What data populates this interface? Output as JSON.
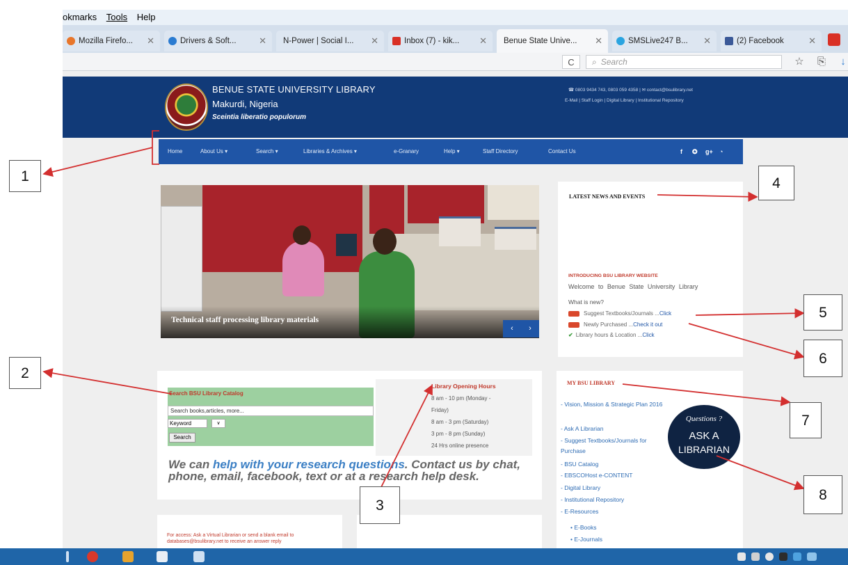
{
  "browser": {
    "menu": [
      "okmarks",
      "Tools",
      "Help"
    ],
    "tabs": [
      {
        "label": "Mozilla Firefo...",
        "color": "#e8762b"
      },
      {
        "label": "Drivers & Soft...",
        "color": "#2a7bd1"
      },
      {
        "label": "N-Power | Social I...",
        "color": "#999999"
      },
      {
        "label": "Inbox (7) - kik...",
        "color": "#d93025"
      },
      {
        "label": "Benue State Unive...",
        "color": "#1a3f7a"
      },
      {
        "label": "SMSLive247 B...",
        "color": "#2aa4e0"
      },
      {
        "label": "(2) Facebook",
        "color": "#3b5998"
      }
    ],
    "reload_icon": "C",
    "search_placeholder": "Search"
  },
  "site": {
    "title": "BENUE STATE UNIVERSITY LIBRARY",
    "location": "Makurdi, Nigeria",
    "motto": "Sceintia liberatio populorum",
    "contact_line": "☎ 0803 9434 743, 0803 059 4358 | ✉ contact@bsulibrary.net",
    "header_links": "E-Mail | Staff Login | Digital Library | Institutional Repository",
    "nav": [
      "Home",
      "About Us ▾",
      "Search ▾",
      "Libraries & Archives ▾",
      "e-Granary",
      "Help ▾",
      "Staff Directory",
      "Contact Us"
    ],
    "social": [
      "f",
      "✪",
      "g+",
      "◔"
    ],
    "slider_caption": "Technical staff processing library materials",
    "slider_prev": "‹",
    "slider_next": "›"
  },
  "news": {
    "title": "LATEST NEWS AND EVENTS",
    "intro": "INTRODUCING BSU LIBRARY WEBSITE",
    "welcome": "Welcome to Benue State University Library",
    "whats_new": "What is new?",
    "items": [
      {
        "text": "Suggest Textbooks/Journals ...",
        "link": "Click"
      },
      {
        "text": "Newly Purchased ...",
        "link": "Check it out"
      },
      {
        "text": "Library hours & Location ...",
        "link": "Click"
      }
    ]
  },
  "catalog": {
    "title": "Search BSU Library Catalog",
    "input_value": "Search books,articles, more...",
    "select_value": "Keyword",
    "select2": "∨",
    "button": "Search"
  },
  "hours": {
    "title": "Library Opening Hours",
    "lines": [
      "8 am - 10 pm (Monday -",
      "Friday)",
      "8 am - 3 pm (Saturday)",
      "3 pm - 8 pm (Sunday)",
      "24 Hrs online presence"
    ]
  },
  "help_text": {
    "part1": "We can ",
    "part2": "help with your research questions",
    "part3": ". Contact us by chat, phone, email, facebook, text or at a research help desk."
  },
  "mybsu": {
    "title": "MY BSU LIBRARY",
    "items": [
      "- Vision, Mission & Strategic Plan 2016",
      "- Ask A Librarian",
      "- Suggest Textbooks/Journals for Purchase",
      "- BSU Catalog",
      "- EBSCOHost e-CONTENT",
      "- Digital Library",
      "- Institutional Repository",
      "- E-Resources"
    ],
    "subitems": [
      "• E-Books",
      "• E-Journals"
    ],
    "ask_q": "Questions ?",
    "ask_l1": "ASK A",
    "ask_l2": "LIBRARIAN"
  },
  "bottom_text": "For access: Ask a Virtual Librarian or send a blank email to databases@bsulibrary.net to receive an answer reply",
  "annotations": [
    "1",
    "2",
    "3",
    "4",
    "5",
    "6",
    "7",
    "8"
  ],
  "colors": {
    "header": "#113a78",
    "nav": "#1f55a6",
    "accent_red": "#c0392b",
    "arrow": "#d32f2f"
  }
}
